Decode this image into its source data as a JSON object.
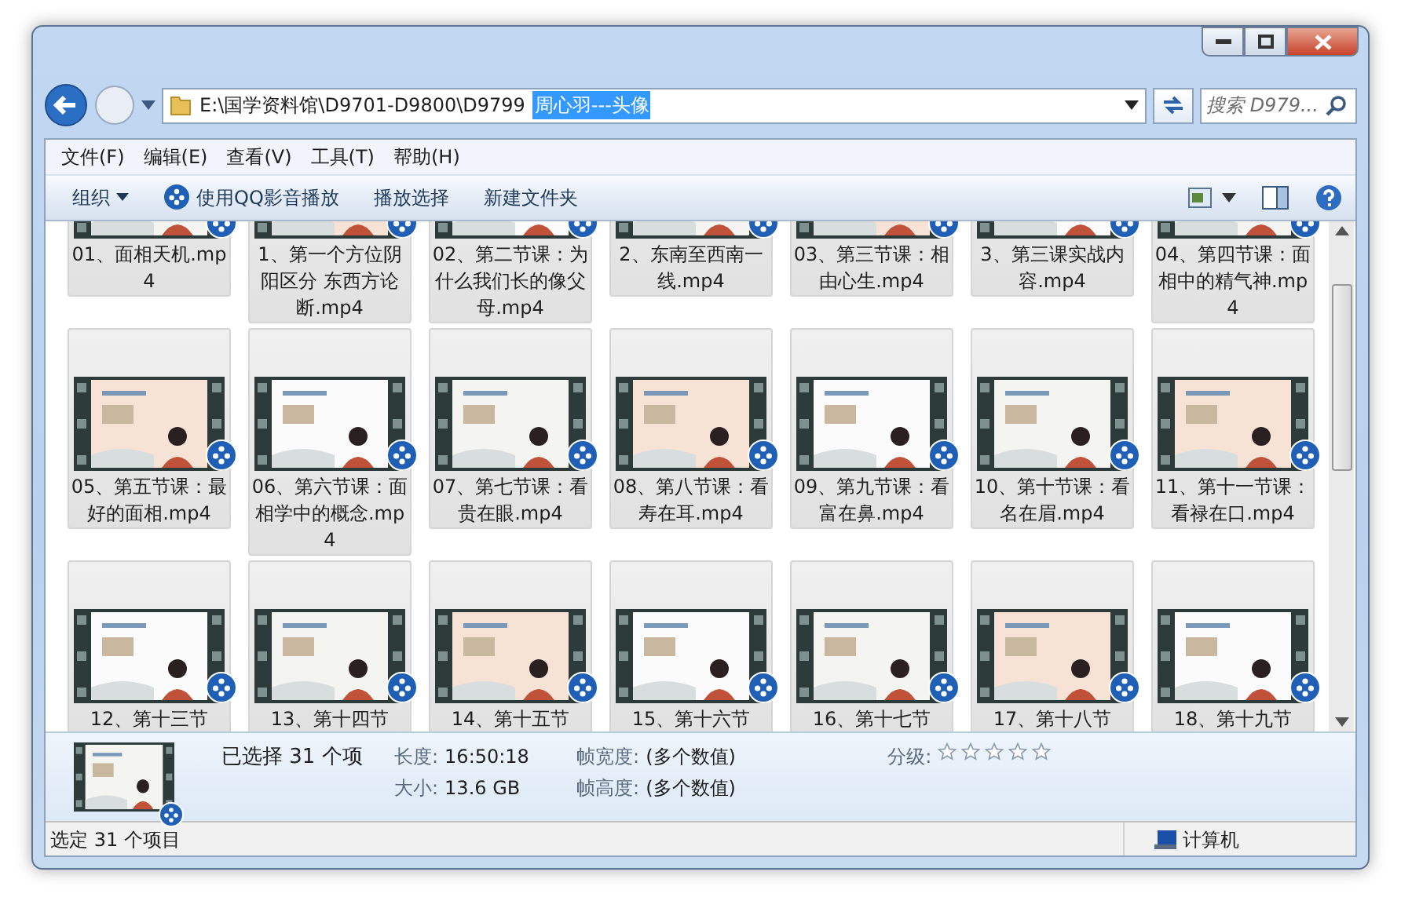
{
  "address": {
    "path": "E:\\国学资料馆\\D9701-D9800\\D9799",
    "selected_text": "周心羽---头像"
  },
  "search": {
    "placeholder": "搜索 D979..."
  },
  "menu": [
    "文件(F)",
    "编辑(E)",
    "查看(V)",
    "工具(T)",
    "帮助(H)"
  ],
  "toolbar": [
    {
      "label": "组织",
      "kind": "menu"
    },
    {
      "label": "使用QQ影音播放",
      "kind": "icon"
    },
    {
      "label": "播放选择",
      "kind": "plain"
    },
    {
      "label": "新建文件夹",
      "kind": "plain"
    }
  ],
  "files": [
    {
      "label": "01、面相天机.mp4",
      "selected": true
    },
    {
      "label": "1、第一个方位阴阳区分 东西方论断.mp4",
      "selected": true
    },
    {
      "label": "02、第二节课：为什么我们长的像父母.mp4",
      "selected": true
    },
    {
      "label": "2、东南至西南一线.mp4",
      "selected": true
    },
    {
      "label": "03、第三节课：相由心生.mp4",
      "selected": true
    },
    {
      "label": "3、第三课实战内容.mp4",
      "selected": true
    },
    {
      "label": "04、第四节课：面相中的精气神.mp4",
      "selected": true
    },
    {
      "label": "05、第五节课：最好的面相.mp4",
      "selected": true
    },
    {
      "label": "06、第六节课：面相学中的概念.mp4",
      "selected": true
    },
    {
      "label": "07、第七节课：看贵在眼.mp4",
      "selected": true
    },
    {
      "label": "08、第八节课：看寿在耳.mp4",
      "selected": true
    },
    {
      "label": "09、第九节课：看富在鼻.mp4",
      "selected": true
    },
    {
      "label": "10、第十节课：看名在眉.mp4",
      "selected": true
    },
    {
      "label": "11、第十一节课：看禄在口.mp4",
      "selected": true
    },
    {
      "label": "12、第十三节",
      "selected": true
    },
    {
      "label": "13、第十四节",
      "selected": true
    },
    {
      "label": "14、第十五节",
      "selected": true
    },
    {
      "label": "15、第十六节",
      "selected": true
    },
    {
      "label": "16、第十七节",
      "selected": true
    },
    {
      "label": "17、第十八节",
      "selected": true
    },
    {
      "label": "18、第十九节",
      "selected": true
    }
  ],
  "details": {
    "selection": "已选择 31 个项",
    "fields": [
      {
        "label": "长度:",
        "value": "16:50:18"
      },
      {
        "label": "帧宽度:",
        "value": "(多个数值)"
      },
      {
        "label": "大小:",
        "value": "13.6 GB"
      },
      {
        "label": "帧高度:",
        "value": "(多个数值)"
      }
    ],
    "rating": {
      "label": "分级:",
      "stars": 0
    }
  },
  "status_bar": {
    "text": "选定 31 个项目",
    "location": "计算机"
  }
}
